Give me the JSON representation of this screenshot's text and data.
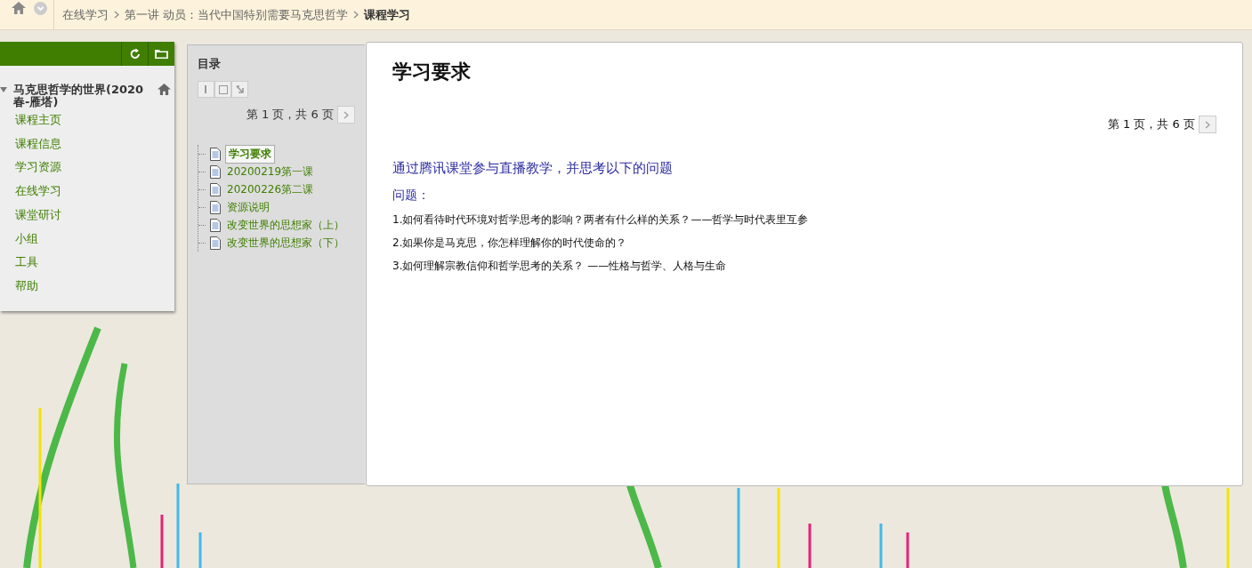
{
  "breadcrumb": {
    "items": [
      {
        "label": "在线学习",
        "current": false
      },
      {
        "label": "第一讲 动员：当代中国特别需要马克思哲学",
        "current": false
      },
      {
        "label": "课程学习",
        "current": true
      }
    ]
  },
  "course_menu": {
    "title": "马克思哲学的世界(2020春-雁塔)",
    "expanded": true,
    "items": [
      {
        "label": "课程主页"
      },
      {
        "label": "课程信息"
      },
      {
        "label": "学习资源"
      },
      {
        "label": "在线学习"
      },
      {
        "label": "课堂研讨"
      },
      {
        "label": "小组"
      },
      {
        "label": "工具"
      },
      {
        "label": "帮助"
      }
    ]
  },
  "toc": {
    "title": "目录",
    "pager": "第 1 页，共 6 页",
    "items": [
      {
        "label": "学习要求",
        "selected": true
      },
      {
        "label": "20200219第一课",
        "selected": false
      },
      {
        "label": "20200226第二课",
        "selected": false
      },
      {
        "label": "资源说明",
        "selected": false
      },
      {
        "label": "改变世界的思想家（上）",
        "selected": false
      },
      {
        "label": "改变世界的思想家（下）",
        "selected": false
      }
    ]
  },
  "content": {
    "title": "学习要求",
    "pager": "第 1 页，共 6 页",
    "intro": "通过腾讯课堂参与直播教学，并思考以下的问题",
    "question_heading": "问题：",
    "questions": [
      "1.如何看待时代环境对哲学思考的影响？两者有什么样的关系？——哲学与时代表里互参",
      "2.如果你是马克思，你怎样理解你的时代使命的？",
      "3.如何理解宗教信仰和哲学思考的关系？ ——性格与哲学、人格与生命"
    ]
  }
}
